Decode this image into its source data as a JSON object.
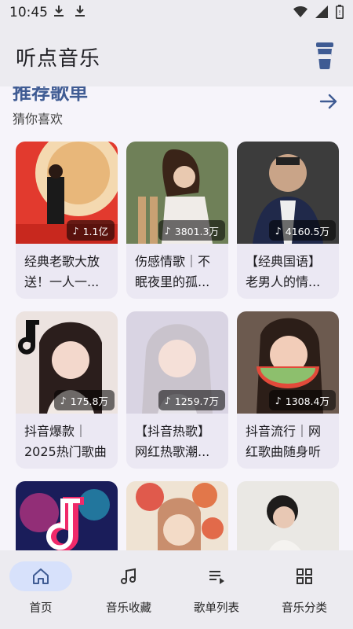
{
  "status_bar": {
    "time": "10:45"
  },
  "app_bar": {
    "title": "听点音乐"
  },
  "section": {
    "title": "推荐歌单",
    "subtitle": "猜你喜欢"
  },
  "playlists": [
    {
      "title": "经典老歌大放送！一人一...",
      "plays": "1.1亿"
    },
    {
      "title": "伤感情歌｜不眠夜里的孤...",
      "plays": "3801.3万"
    },
    {
      "title": "【经典国语】老男人的情...",
      "plays": "4160.5万"
    },
    {
      "title": "抖音爆款｜2025热门歌曲",
      "plays": "175.8万"
    },
    {
      "title": "【抖音热歌】网红热歌潮...",
      "plays": "1259.7万"
    },
    {
      "title": "抖音流行｜网红歌曲随身听",
      "plays": "1308.4万"
    },
    {
      "title": "",
      "plays": ""
    },
    {
      "title": "",
      "plays": ""
    },
    {
      "title": "",
      "plays": ""
    }
  ],
  "bottom_nav": [
    {
      "label": "首页",
      "icon": "home-icon",
      "active": true
    },
    {
      "label": "音乐收藏",
      "icon": "music-note-icon",
      "active": false
    },
    {
      "label": "歌单列表",
      "icon": "playlist-icon",
      "active": false
    },
    {
      "label": "音乐分类",
      "icon": "grid-icon",
      "active": false
    }
  ],
  "colors": {
    "accent": "#3f5b93",
    "nav_active": "#d7e1fb",
    "background": "#f6f4fa",
    "bar": "#ecebf0"
  }
}
